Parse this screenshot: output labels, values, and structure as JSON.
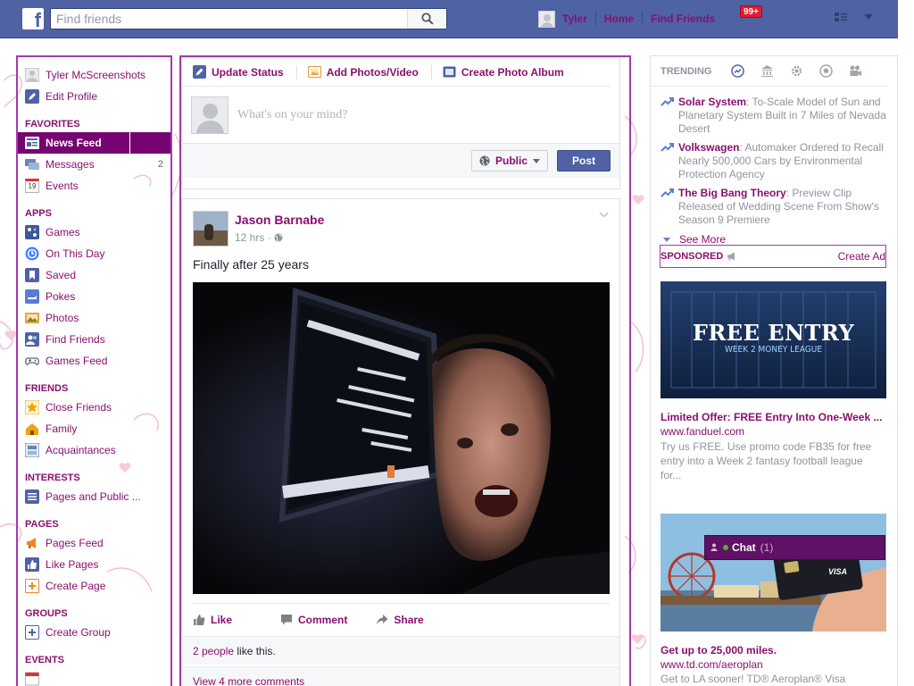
{
  "topbar": {
    "logo_letter": "f",
    "search_placeholder": "Find friends",
    "user_name": "Tyler",
    "home_label": "Home",
    "find_friends_label": "Find Friends",
    "notif_count": "99+"
  },
  "leftnav": {
    "profile_name": "Tyler McScreenshots",
    "edit_profile": "Edit Profile",
    "favorites_heading": "FAVORITES",
    "favorites": [
      {
        "label": "News Feed",
        "count": ""
      },
      {
        "label": "Messages",
        "count": "2"
      },
      {
        "label": "Events",
        "count": ""
      }
    ],
    "apps_heading": "APPS",
    "apps": [
      {
        "label": "Games"
      },
      {
        "label": "On This Day"
      },
      {
        "label": "Saved"
      },
      {
        "label": "Pokes"
      },
      {
        "label": "Photos"
      },
      {
        "label": "Find Friends"
      },
      {
        "label": "Games Feed"
      }
    ],
    "friends_heading": "FRIENDS",
    "friends": [
      {
        "label": "Close Friends"
      },
      {
        "label": "Family"
      },
      {
        "label": "Acquaintances"
      }
    ],
    "interests_heading": "INTERESTS",
    "interests": [
      {
        "label": "Pages and Public ..."
      }
    ],
    "pages_heading": "PAGES",
    "pages": [
      {
        "label": "Pages Feed"
      },
      {
        "label": "Like Pages"
      },
      {
        "label": "Create Page"
      }
    ],
    "groups_heading": "GROUPS",
    "groups": [
      {
        "label": "Create Group"
      }
    ],
    "events_heading": "EVENTS",
    "events_cal_day": "19"
  },
  "composer": {
    "tab_status": "Update Status",
    "tab_photos": "Add Photos/Video",
    "tab_album": "Create Photo Album",
    "placeholder": "What's on your mind?",
    "privacy": "Public",
    "post_button": "Post"
  },
  "post": {
    "author": "Jason Barnabe",
    "time": "12 hrs",
    "text": "Finally after 25 years",
    "like_label": "Like",
    "comment_label": "Comment",
    "share_label": "Share",
    "likes_people": "2 people",
    "likes_suffix": " like this.",
    "view_comments": "View 4 more comments"
  },
  "trending": {
    "heading": "TRENDING",
    "items": [
      {
        "title": "Solar System",
        "desc": ": To-Scale Model of Sun and Planetary System Built in 7 Miles of Nevada Desert"
      },
      {
        "title": "Volkswagen",
        "desc": ": Automaker Ordered to Recall Nearly 500,000 Cars by Environmental Protection Agency"
      },
      {
        "title": "The Big Bang Theory",
        "desc": ": Preview Clip Released of Wedding Scene From Show's Season 9 Premiere"
      }
    ],
    "see_more": "See More"
  },
  "sponsored": {
    "heading": "SPONSORED",
    "create_ad": "Create Ad",
    "ad1": {
      "image_title": "FREE ENTRY",
      "image_subtitle": "WEEK 2 MONEY LEAGUE",
      "title": "Limited Offer: FREE Entry Into One-Week ...",
      "url": "www.fanduel.com",
      "body": "Try us FREE. Use promo code FB35 for free entry into a Week 2 fantasy football league for..."
    },
    "ad2": {
      "card_label": "VISA",
      "title": "Get up to 25,000 miles.",
      "url": "www.td.com/aeroplan",
      "body": "Get to LA sooner! TD® Aeroplan® Visa"
    }
  },
  "chat": {
    "label": "Chat",
    "count": "(1)"
  },
  "colors": {
    "topbar": "#4f62a4",
    "link": "#8a0f6f",
    "active_nav": "#760470",
    "outline": "#a23ca8"
  }
}
